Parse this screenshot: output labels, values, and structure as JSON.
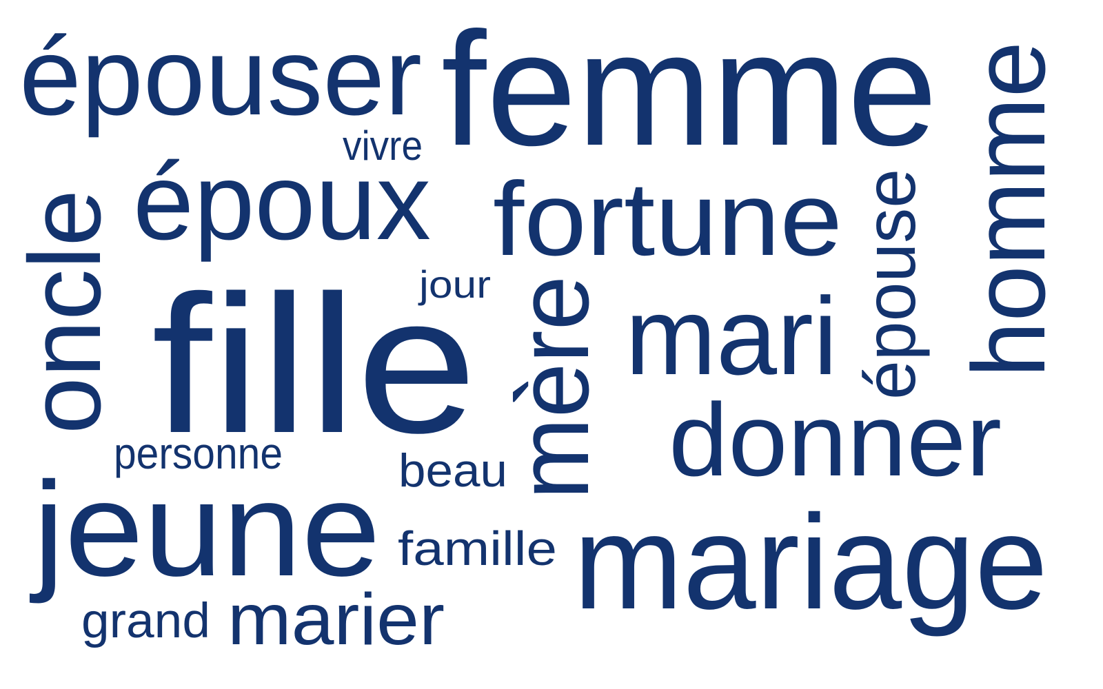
{
  "color": "#13336e",
  "words": {
    "epouser": "épouser",
    "femme": "femme",
    "vivre": "vivre",
    "epoux": "époux",
    "fortune": "fortune",
    "oncle": "oncle",
    "jour": "jour",
    "fille": "fille",
    "mere": "mère",
    "mari": "mari",
    "epouse": "épouse",
    "homme": "homme",
    "donner": "donner",
    "personne": "personne",
    "beau": "beau",
    "jeune": "jeune",
    "famille": "famille",
    "mariage": "mariage",
    "grand": "grand",
    "marier": "marier"
  }
}
